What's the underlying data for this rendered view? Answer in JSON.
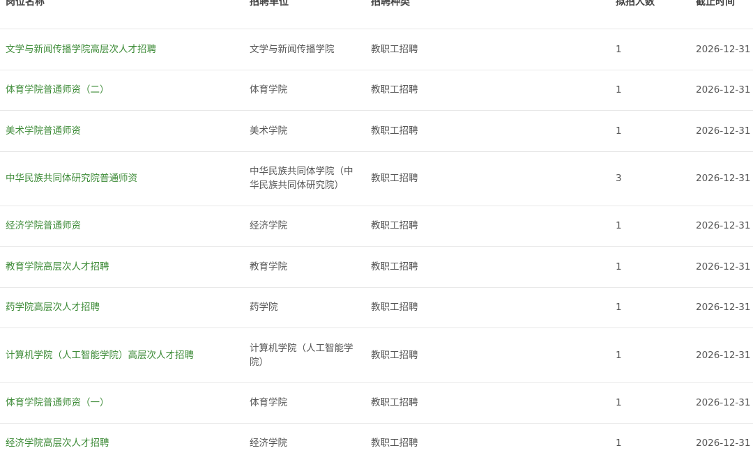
{
  "table": {
    "headers": {
      "name": "岗位名称",
      "unit": "招聘单位",
      "type": "招聘种类",
      "count": "拟招人数",
      "deadline": "截止时间"
    },
    "rows": [
      {
        "name": "文学与新闻传播学院高层次人才招聘",
        "unit": "文学与新闻传播学院",
        "type": "教职工招聘",
        "count": "1",
        "deadline": "2026-12-31"
      },
      {
        "name": "体育学院普通师资（二）",
        "unit": "体育学院",
        "type": "教职工招聘",
        "count": "1",
        "deadline": "2026-12-31"
      },
      {
        "name": "美术学院普通师资",
        "unit": "美术学院",
        "type": "教职工招聘",
        "count": "1",
        "deadline": "2026-12-31"
      },
      {
        "name": "中华民族共同体研究院普通师资",
        "unit": "中华民族共同体学院（中华民族共同体研究院）",
        "type": "教职工招聘",
        "count": "3",
        "deadline": "2026-12-31"
      },
      {
        "name": "经济学院普通师资",
        "unit": "经济学院",
        "type": "教职工招聘",
        "count": "1",
        "deadline": "2026-12-31"
      },
      {
        "name": "教育学院高层次人才招聘",
        "unit": "教育学院",
        "type": "教职工招聘",
        "count": "1",
        "deadline": "2026-12-31"
      },
      {
        "name": "药学院高层次人才招聘",
        "unit": "药学院",
        "type": "教职工招聘",
        "count": "1",
        "deadline": "2026-12-31"
      },
      {
        "name": "计算机学院（人工智能学院）高层次人才招聘",
        "unit": "计算机学院（人工智能学院）",
        "type": "教职工招聘",
        "count": "1",
        "deadline": "2026-12-31"
      },
      {
        "name": "体育学院普通师资（一）",
        "unit": "体育学院",
        "type": "教职工招聘",
        "count": "1",
        "deadline": "2026-12-31"
      },
      {
        "name": "经济学院高层次人才招聘",
        "unit": "经济学院",
        "type": "教职工招聘",
        "count": "1",
        "deadline": "2026-12-31"
      }
    ]
  },
  "colors": {
    "link": "#3d8b37",
    "text": "#555555",
    "header": "#444444",
    "divider": "#e8e8e8"
  }
}
